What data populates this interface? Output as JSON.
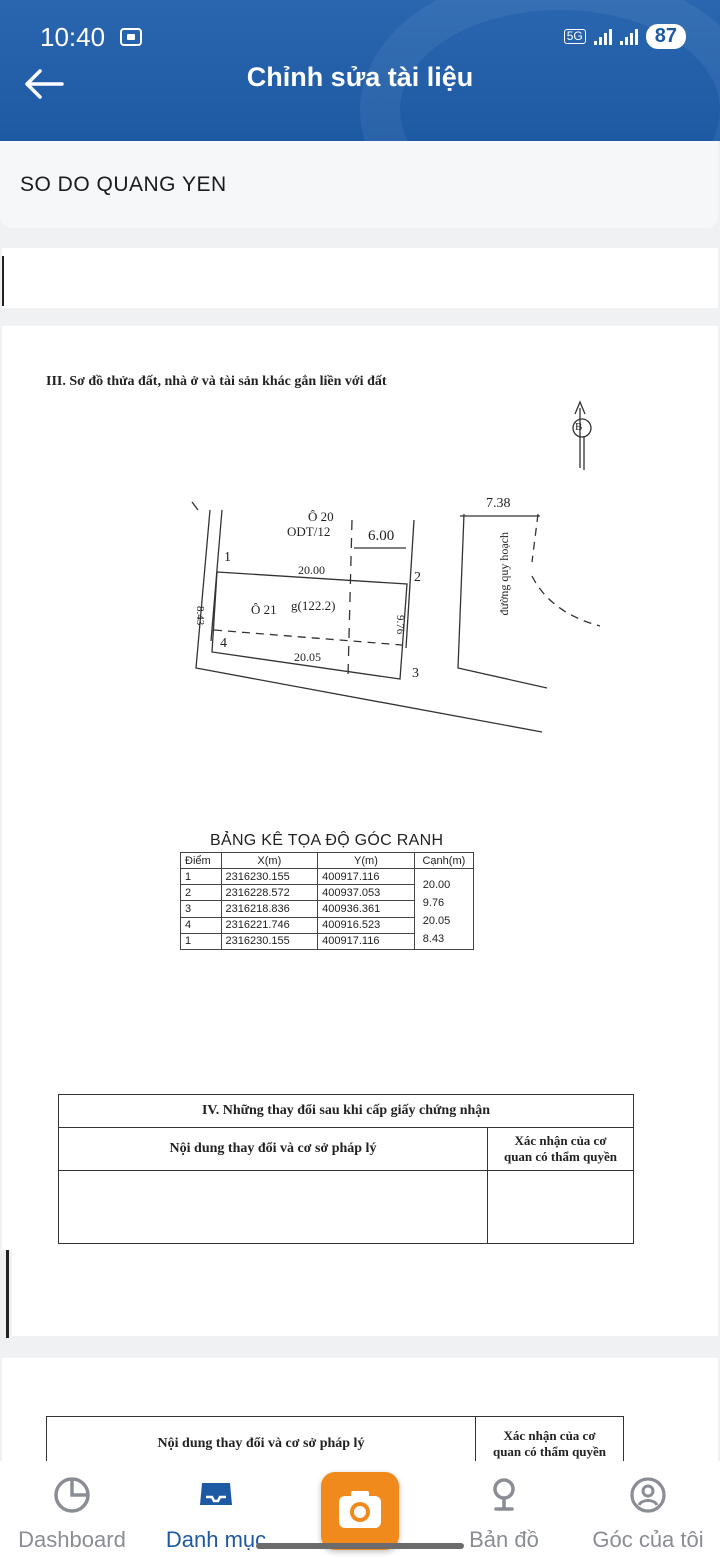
{
  "status_bar": {
    "time": "10:40",
    "network": "5G",
    "battery": "87"
  },
  "header": {
    "title": "Chỉnh sửa tài liệu"
  },
  "document": {
    "name": "SO DO QUANG YEN"
  },
  "page2": {
    "section_title": "III. Sơ đồ thửa đất, nhà ở và tài sản khác gắn liền với đất",
    "plan": {
      "north": "B",
      "parcel_top_label": "Ô 20",
      "parcel_top_code": "ODT/12",
      "parcel_label": "Ô 21",
      "parcel_area": "g(122.2)",
      "dim_road_width": "6.00",
      "dim_right_width": "7.38",
      "road_label": "đường quy hoạch",
      "edge_top": "20.00",
      "edge_bottom": "20.05",
      "edge_left": "8.43",
      "edge_right": "9.76",
      "corners": [
        "1",
        "2",
        "3",
        "4"
      ]
    },
    "coord_table": {
      "title": "BẢNG KÊ TỌA ĐỘ GÓC RANH",
      "headers": [
        "Điểm",
        "X(m)",
        "Y(m)",
        "Cạnh(m)"
      ],
      "rows": [
        {
          "point": "1",
          "x": "2316230.155",
          "y": "400917.116"
        },
        {
          "point": "2",
          "x": "2316228.572",
          "y": "400937.053"
        },
        {
          "point": "3",
          "x": "2316218.836",
          "y": "400936.361"
        },
        {
          "point": "4",
          "x": "2316221.746",
          "y": "400916.523"
        },
        {
          "point": "1",
          "x": "2316230.155",
          "y": "400917.116"
        }
      ],
      "edges": [
        "20.00",
        "9.76",
        "20.05",
        "8.43"
      ]
    },
    "changes": {
      "title": "IV. Những thay đổi sau khi cấp giấy chứng nhận",
      "col_content": "Nội dung thay đổi và cơ sở pháp lý",
      "col_confirm_line1": "Xác nhận của cơ",
      "col_confirm_line2": "quan có thẩm quyền"
    }
  },
  "page3": {
    "col_content": "Nội dung thay đổi và cơ sở pháp lý",
    "col_confirm_line1": "Xác nhận của cơ",
    "col_confirm_line2": "quan có thẩm quyền"
  },
  "bottom_nav": {
    "items": [
      {
        "label": "Dashboard"
      },
      {
        "label": "Danh mục"
      },
      {
        "label": "Bản đồ"
      },
      {
        "label": "Góc của tôi"
      }
    ]
  },
  "colors": {
    "header_blue": "#1d5aa3",
    "accent_orange": "#f08a1c",
    "nav_inactive": "#8a8d93"
  }
}
